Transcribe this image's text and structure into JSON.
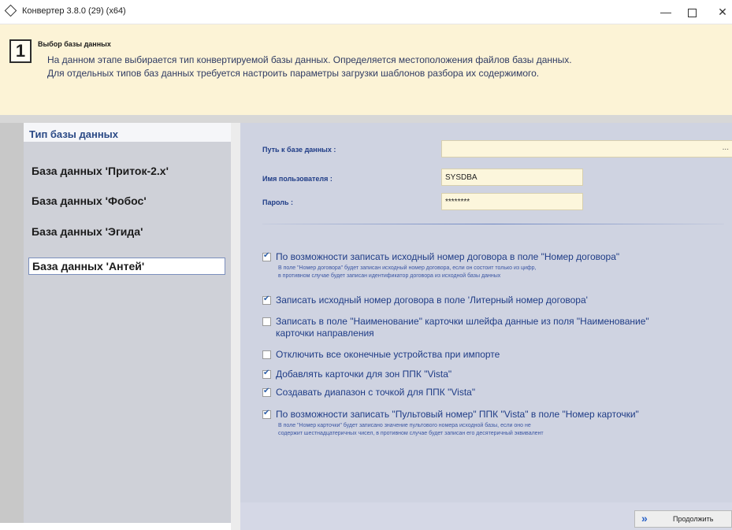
{
  "window": {
    "title": "Конвертер 3.8.0 (29) (x64)",
    "minimize": "—",
    "close": "✕"
  },
  "header": {
    "step": "1",
    "title": "Выбор базы данных",
    "line1": "На данном этапе выбирается тип конвертируемой базы данных. Определяется местоположения файлов базы данных.",
    "line2": "Для отдельных типов баз данных требуется настроить параметры загрузки шаблонов разбора их содержимого."
  },
  "sidebar": {
    "heading": "Тип базы данных",
    "items": [
      {
        "label": "База данных 'Приток-2.x'"
      },
      {
        "label": "База данных 'Фобос'"
      },
      {
        "label": "База данных 'Эгида'"
      },
      {
        "label": "База данных 'Антей'",
        "selected": true
      }
    ]
  },
  "form": {
    "path_label": "Путь к базе данных :",
    "path_value": "",
    "browse": "...",
    "user_label": "Имя пользователя :",
    "user_value": "SYSDBA",
    "password_label": "Пароль :",
    "password_value": "********"
  },
  "options": [
    {
      "label": "По возможности записать исходный номер договора в поле \"Номер договора\"",
      "checked": true,
      "note1": "В поле \"Номер договора\" будет записан исходный номер договора, если он состоит только из цифр,",
      "note2": "в противном случае будет записан идентификатор договора из исходной базы данных"
    },
    {
      "label": "Записать исходный номер договора в поле 'Литерный номер договора'",
      "checked": true
    },
    {
      "label": "Записать в поле \"Наименование\" карточки шлейфа данные из поля \"Наименование\"",
      "label2": "карточки направления",
      "checked": false
    },
    {
      "label": "Отключить все оконечные устройства при импорте",
      "checked": false
    },
    {
      "label": "Добавлять карточки для зон ППК \"Vista\"",
      "checked": true
    },
    {
      "label": "Создавать диапазон с точкой для ППК \"Vista\"",
      "checked": true
    },
    {
      "label": "По возможности записать \"Пультовый номер\" ППК \"Vista\" в поле \"Номер карточки\"",
      "checked": true,
      "note1": "В поле \"Номер карточки\" будет записано значение пультового номера исходной базы, если оно не",
      "note2": "содержит шестнадцатеричных чисел, в противном случае будет записан его десятеричный эквивалент"
    }
  ],
  "footer": {
    "next_icon": "»",
    "next_label": "Продолжить"
  },
  "colors": {
    "header_bg": "#fcf3d6",
    "panel_bg": "#cfd3e1",
    "sidebar_bg": "#cfd1d8",
    "label_blue": "#1f3c86"
  }
}
